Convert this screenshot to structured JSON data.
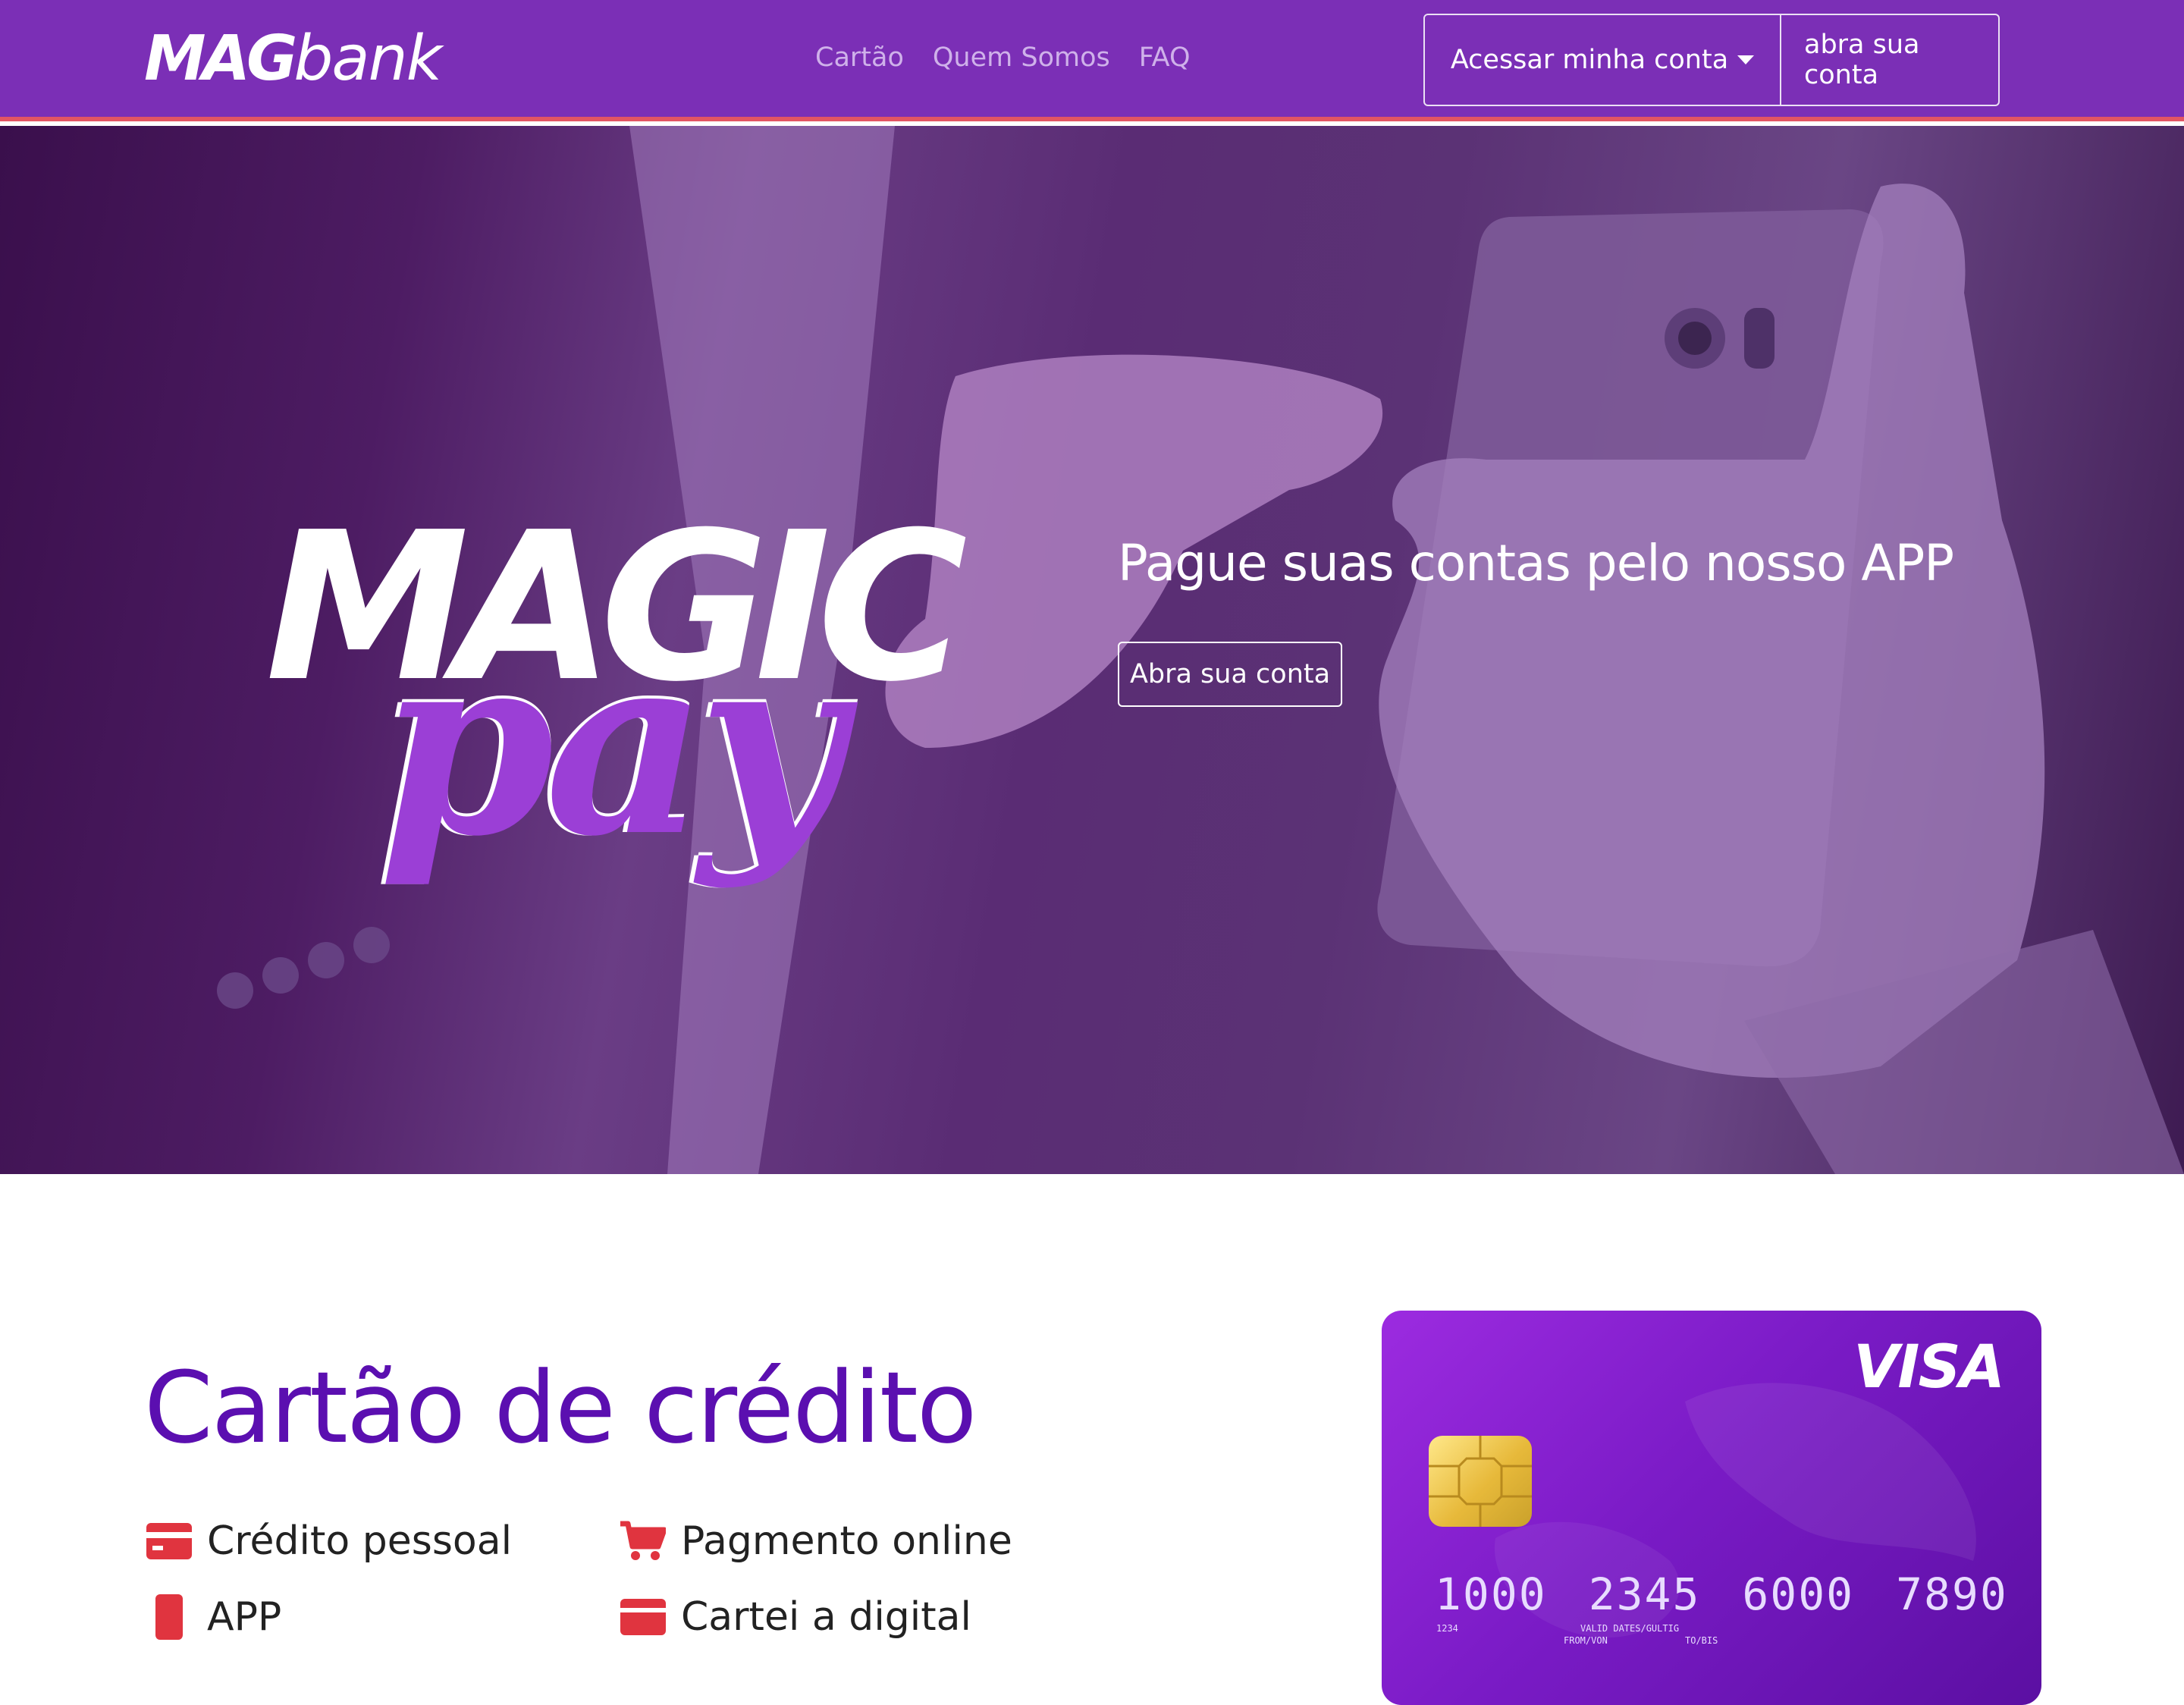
{
  "navbar": {
    "logo_bold": "MAG",
    "logo_light": "bank",
    "links": [
      "Cartão",
      "Quem Somos",
      "FAQ"
    ],
    "login_button": "Acessar minha conta",
    "open_account_button": "abra sua conta"
  },
  "hero": {
    "brand_word_1": "MAGIC",
    "brand_word_2": "pay",
    "headline": "Pague suas contas pelo nosso APP",
    "cta": "Abra sua conta"
  },
  "credit": {
    "title": "Cartão de crédito",
    "features": [
      {
        "label": "Crédito pessoal",
        "icon": "credit-card-icon"
      },
      {
        "label": "Pagmento online",
        "icon": "shopping-cart-icon"
      },
      {
        "label": "APP",
        "icon": "mobile-icon"
      },
      {
        "label": "Cartei a digital",
        "icon": "wallet-icon"
      }
    ]
  },
  "card": {
    "brand": "VISA",
    "number_groups": [
      "1000",
      "2345",
      "6000",
      "7890"
    ],
    "small_code": "1234",
    "valid_label": "VALID DATES/GULTIG",
    "from_label": "FROM/VON",
    "to_label": "TO/BIS"
  },
  "colors": {
    "navbar_bg": "#7b2fb6",
    "navbar_border": "#e25563",
    "title_purple": "#5b0fb0",
    "icon_red": "#e0343f"
  }
}
